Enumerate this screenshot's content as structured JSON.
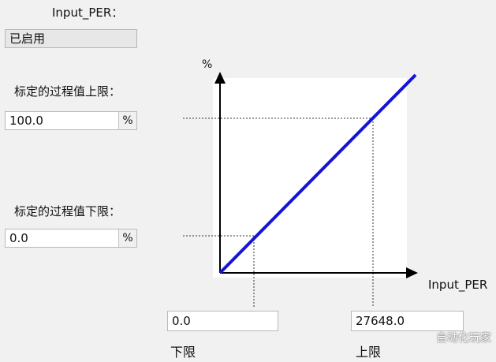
{
  "input_per": {
    "label": "Input_PER：",
    "status_value": "已启用"
  },
  "upper": {
    "label": "标定的过程值上限：",
    "value": "100.0",
    "unit": "%"
  },
  "lower": {
    "label": "标定的过程值下限：",
    "value": "0.0",
    "unit": "%"
  },
  "chart": {
    "y_axis_label": "%",
    "x_axis_label": "Input_PER",
    "line_color": "#1414d8",
    "x_low_value": "0.0",
    "x_high_value": "27648.0",
    "x_low_label": "下限",
    "x_high_label": "上限"
  },
  "watermark": "自动化玩家"
}
